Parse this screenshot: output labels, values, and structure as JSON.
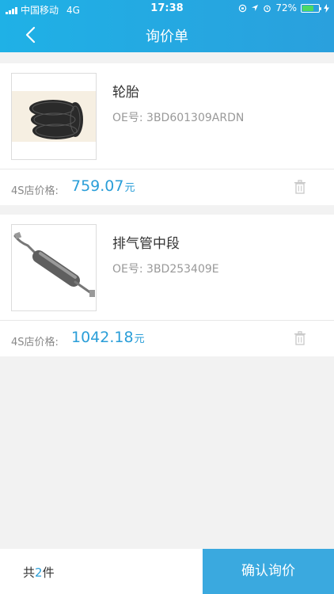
{
  "status": {
    "carrier": "中国移动",
    "network": "4G",
    "time": "17:38",
    "battery": "72%",
    "battery_level": 0.72
  },
  "nav": {
    "title": "询价单"
  },
  "items": [
    {
      "name": "轮胎",
      "oe": "OE号: 3BD601309ARDN",
      "price_label": "4S店价格:",
      "price": "759.07",
      "unit": "元"
    },
    {
      "name": "排气管中段",
      "oe": "OE号: 3BD253409E",
      "price_label": "4S店价格:",
      "price": "1042.18",
      "unit": "元"
    }
  ],
  "footer": {
    "total_prefix": "共",
    "total_count": "2",
    "total_suffix": "件",
    "confirm_label": "确认询价"
  },
  "colors": {
    "header": "#2aa8e2",
    "accent": "#2a9ed8",
    "button": "#3aa9df"
  }
}
